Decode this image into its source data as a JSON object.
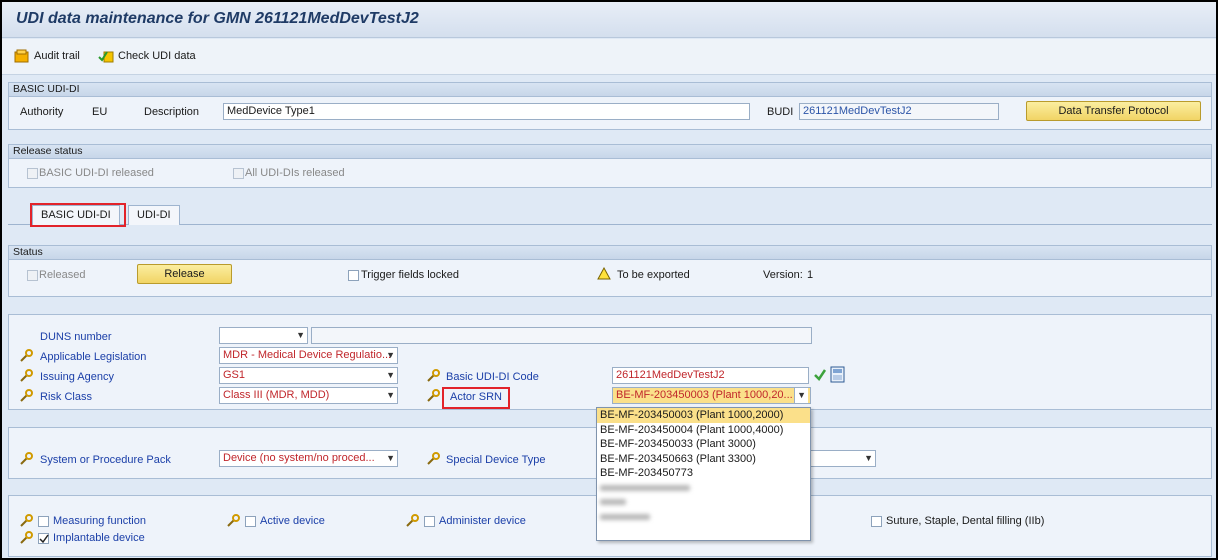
{
  "window": {
    "title": "UDI data maintenance for GMN 261121MedDevTestJ2"
  },
  "toolbar": {
    "audit_trail": "Audit trail",
    "check_udi": "Check UDI data"
  },
  "basic_section": {
    "header": "BASIC UDI-DI",
    "authority_label": "Authority",
    "authority_value": "EU",
    "description_label": "Description",
    "description_value": "MedDevice Type1",
    "budi_label": "BUDI",
    "budi_value": "261121MedDevTestJ2",
    "transfer_button": "Data Transfer Protocol"
  },
  "release_section": {
    "header": "Release status",
    "basic_released": "BASIC UDI-DI released",
    "all_released": "All UDI-DIs released"
  },
  "tabs": [
    {
      "label": "BASIC UDI-DI"
    },
    {
      "label": "UDI-DI"
    }
  ],
  "status_section": {
    "header": "Status",
    "released_label": "Released",
    "release_button": "Release",
    "trigger_locked": "Trigger fields locked",
    "export_status": "To be exported",
    "version_label": "Version:",
    "version_value": "1"
  },
  "fields": {
    "duns_label": "DUNS number",
    "legislation_label": "Applicable Legislation",
    "legislation_value": "MDR - Medical Device Regulatio...",
    "agency_label": "Issuing Agency",
    "agency_value": "GS1",
    "risk_label": "Risk Class",
    "risk_value": "Class III (MDR, MDD)",
    "basic_code_label": "Basic UDI-DI Code",
    "basic_code_value": "261121MedDevTestJ2",
    "actor_label": "Actor SRN",
    "actor_value": "BE-MF-203450003 (Plant 1000,20..."
  },
  "actor_options": [
    "BE-MF-203450003 (Plant 1000,2000)",
    "BE-MF-203450004 (Plant 1000,4000)",
    "BE-MF-203450033 (Plant 3000)",
    "BE-MF-203450663 (Plant 3300)",
    "BE-MF-203450773"
  ],
  "system_section": {
    "system_label": "System or Procedure Pack",
    "system_value": "Device (no system/no proced...",
    "special_label": "Special Device Type"
  },
  "flags": {
    "measuring": "Measuring function",
    "active": "Active device",
    "administer": "Administer device",
    "suture": "Suture, Staple, Dental filling (IIb)",
    "implantable": "Implantable device"
  },
  "colors": {
    "accent_red": "#e2232a",
    "button_yellow": "#f1d465",
    "selected_yellow": "#fbe08a",
    "link_blue": "#1b3fa8"
  }
}
